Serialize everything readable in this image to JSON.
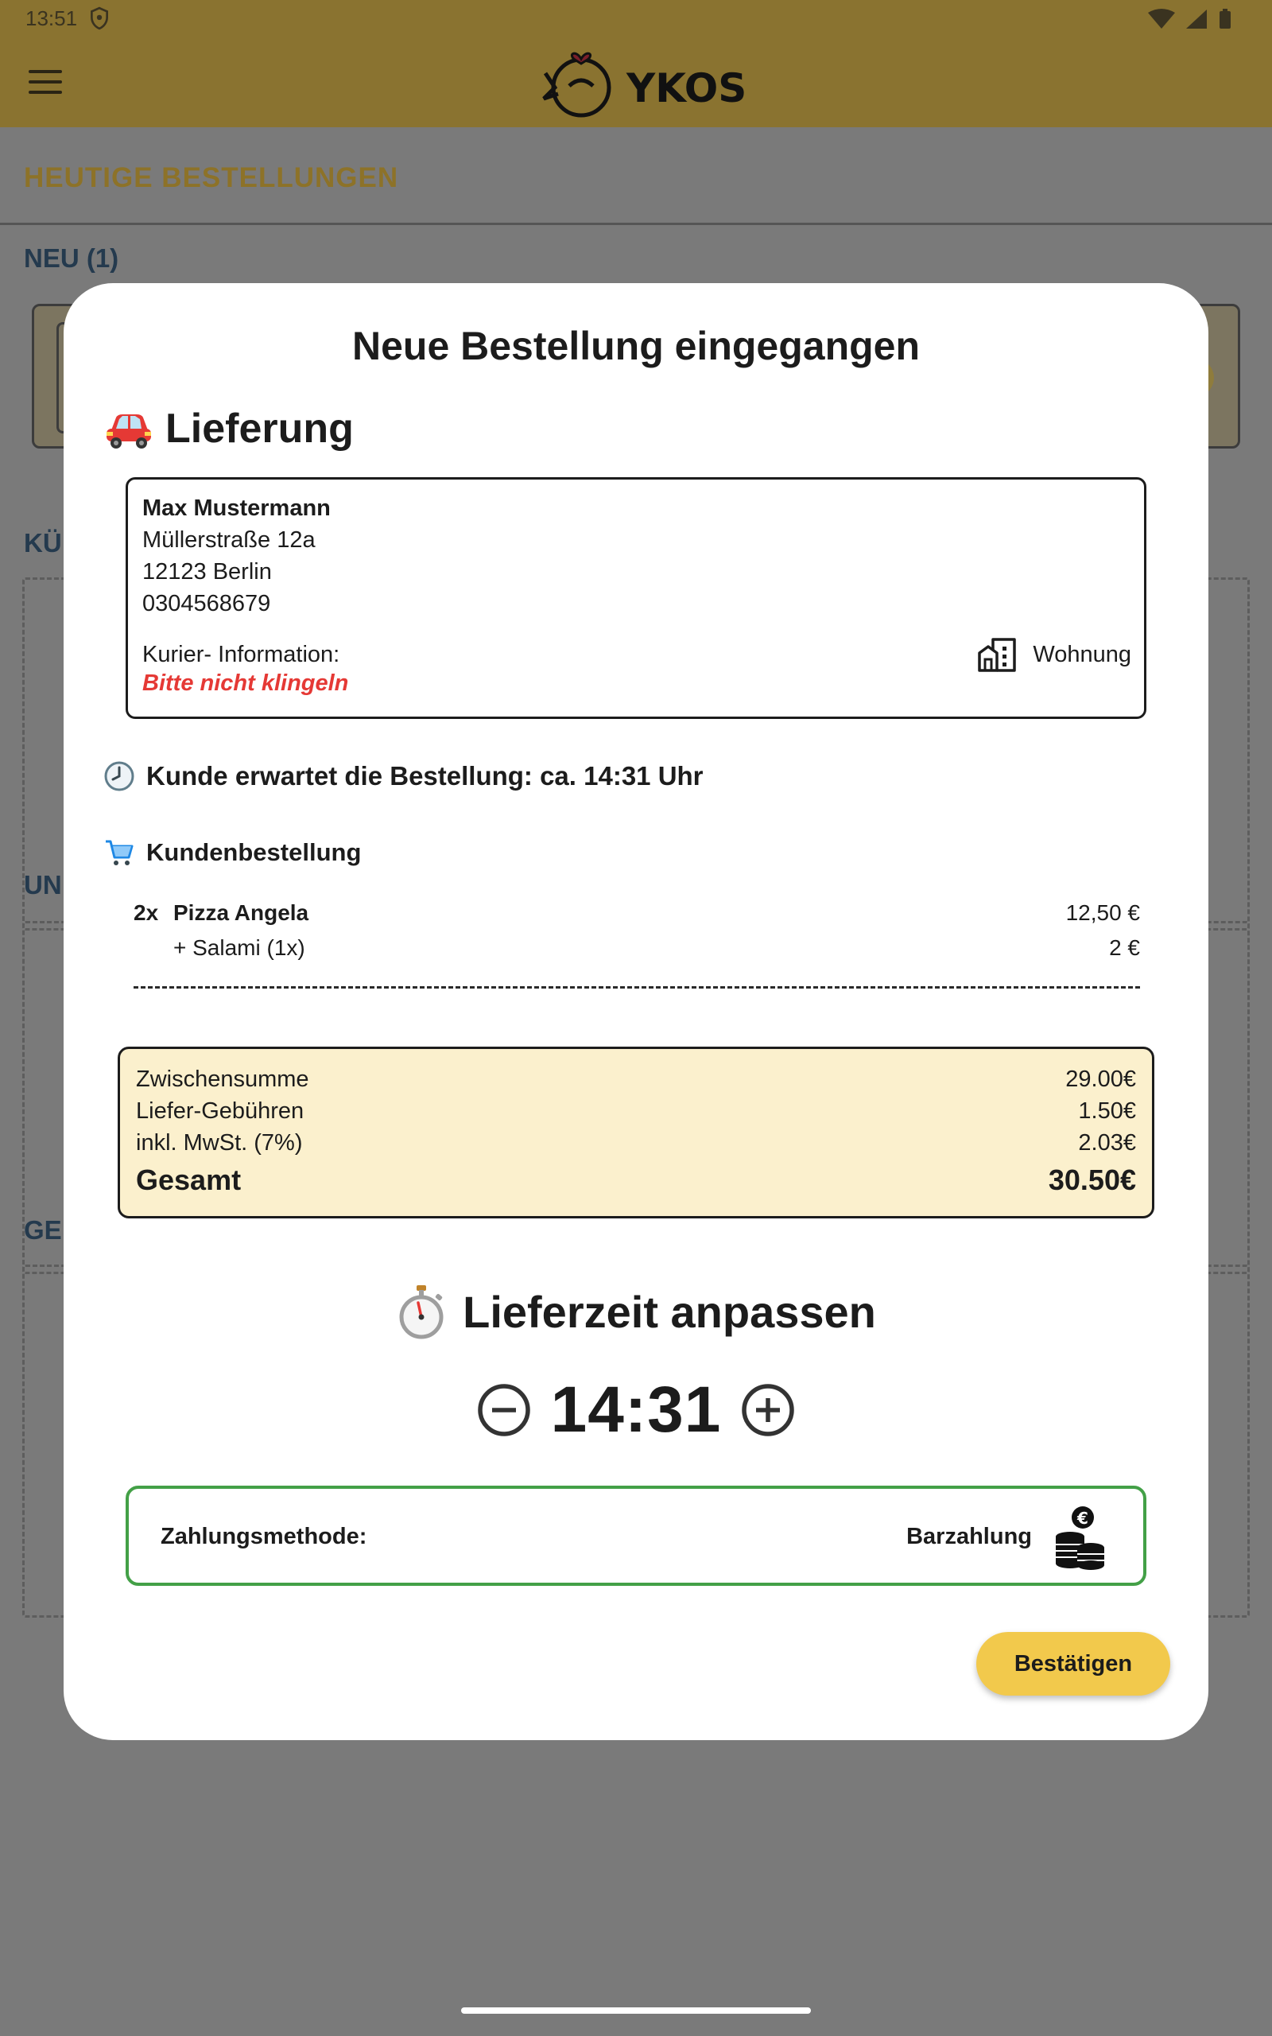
{
  "status_bar": {
    "time": "13:51"
  },
  "app_bar": {
    "logo_text": "YKOS"
  },
  "background": {
    "page_heading": "HEUTIGE BESTELLUNGEN",
    "section_new": "NEU (1)",
    "section_2": "KÜ",
    "section_3": "UN",
    "section_4": "GE"
  },
  "dialog": {
    "title": "Neue Bestellung eingegangen",
    "order_type": "Lieferung",
    "customer": {
      "name": "Max Mustermann",
      "street": "Müllerstraße 12a",
      "city": "12123 Berlin",
      "phone": "0304568679",
      "courier_info_label": "Kurier- Information:",
      "courier_note": "Bitte nicht klingeln",
      "building_type": "Wohnung"
    },
    "expected_text": "Kunde erwartet die Bestellung: ca. 14:31 Uhr",
    "order_heading": "Kundenbestellung",
    "items": [
      {
        "qty": "2x",
        "name": "Pizza Angela",
        "price": "12,50 €"
      },
      {
        "qty": "",
        "name": "+ Salami (1x)",
        "price": "2 €"
      }
    ],
    "totals": {
      "subtotal_label": "Zwischensumme",
      "subtotal": "29.00€",
      "delivery_label": "Liefer-Gebühren",
      "delivery": "1.50€",
      "vat_label": "inkl. MwSt. (7%)",
      "vat": "2.03€",
      "total_label": "Gesamt",
      "total": "30.50€"
    },
    "adjust_title": "Lieferzeit anpassen",
    "delivery_time": "14:31",
    "payment_label": "Zahlungsmethode:",
    "payment_method": "Barzahlung",
    "confirm_label": "Bestätigen"
  },
  "colors": {
    "accent": "#f2c94c",
    "alert": "#e53935",
    "payment_border": "#43a047",
    "totals_bg": "#fbf0cd"
  }
}
